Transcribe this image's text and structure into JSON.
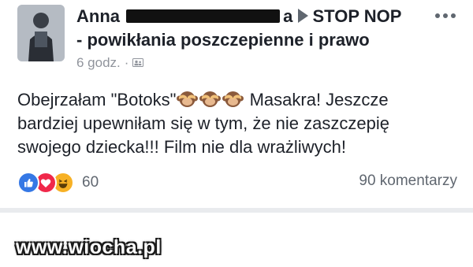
{
  "post": {
    "author_first_name": "Anna",
    "author_name_suffix": "a",
    "group_name_line1": "STOP NOP",
    "group_name_line2": "- powikłania poszczepienne i prawo",
    "timestamp": "6 godz.",
    "meta_separator": "·",
    "body_line1_before": "Obejrzałam \"Botoks\"",
    "body_line1_after": " Masakra! Jeszcze",
    "body_line2": "bardziej upewniłam się w tym, że nie zaszczepię",
    "body_line3": "swojego dziecka!!! Film nie dla wrażliwych!",
    "emoji": [
      "see-no-evil-monkey",
      "see-no-evil-monkey",
      "see-no-evil-monkey"
    ]
  },
  "reactions": {
    "types": [
      "like",
      "love",
      "haha"
    ],
    "count": "60"
  },
  "comments": {
    "label": "90 komentarzy"
  },
  "watermark": {
    "text": "www.wiocha.pl"
  },
  "colors": {
    "like": "#3578e5",
    "love": "#f0284a",
    "haha": "#f7b125",
    "text": "#1d2129",
    "meta": "#90949c",
    "redaction": "#111111"
  }
}
